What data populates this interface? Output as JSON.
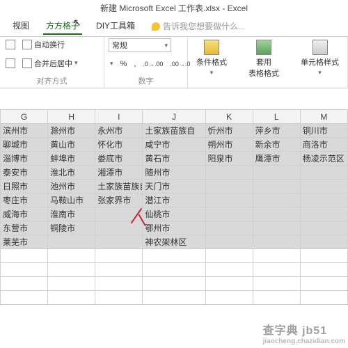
{
  "title": "新建 Microsoft Excel 工作表.xlsx - Excel",
  "tabs": {
    "view": "视图",
    "fangfang": "方方格子",
    "diy": "DIY工具箱",
    "tellme": "告诉我您想要做什么..."
  },
  "ribbon": {
    "wrap": "自动换行",
    "merge": "合并后居中",
    "align_label": "对齐方式",
    "numfmt": "常规",
    "pct": "%",
    "comma": ",",
    "dec_inc": ".0 .00",
    "dec_dec": ".00 .0",
    "num_label": "数字",
    "cond": "条件格式",
    "tbl": "套用\n表格格式",
    "cell": "单元格样式"
  },
  "cols": [
    "G",
    "H",
    "I",
    "J",
    "K",
    "L",
    "M"
  ],
  "chart_data": {
    "type": "table",
    "columns": [
      "G",
      "H",
      "I",
      "J",
      "K",
      "L",
      "M"
    ],
    "rows": [
      [
        "滨州市",
        "滁州市",
        "永州市",
        "土家族苗族自",
        "忻州市",
        "萍乡市",
        "铜川市"
      ],
      [
        "聊城市",
        "黄山市",
        "怀化市",
        "咸宁市",
        "朔州市",
        "新余市",
        "商洛市"
      ],
      [
        "淄博市",
        "蚌埠市",
        "娄底市",
        "黄石市",
        "阳泉市",
        "鹰潭市",
        "杨凌示范区"
      ],
      [
        "泰安市",
        "淮北市",
        "湘潭市",
        "随州市",
        "",
        "",
        ""
      ],
      [
        "日照市",
        "池州市",
        "土家族苗族自",
        "天门市",
        "",
        "",
        ""
      ],
      [
        "枣庄市",
        "马鞍山市",
        "张家界市",
        "潜江市",
        "",
        "",
        ""
      ],
      [
        "威海市",
        "淮南市",
        "",
        "仙桃市",
        "",
        "",
        ""
      ],
      [
        "东营市",
        "铜陵市",
        "",
        "鄂州市",
        "",
        "",
        ""
      ],
      [
        "莱芜市",
        "",
        "",
        "神农架林区",
        "",
        "",
        ""
      ]
    ]
  },
  "watermark": {
    "main": "查字典 jb51",
    "sub": "jiaocheng.chazidian.com"
  }
}
